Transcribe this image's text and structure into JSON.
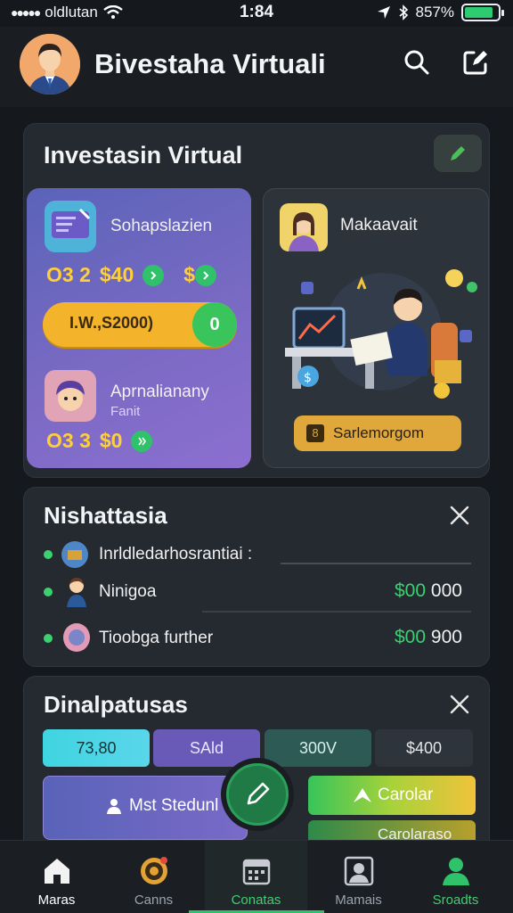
{
  "status_bar": {
    "carrier": "oldlutan",
    "time": "1:84",
    "battery": "857%",
    "battery_level": 0.86
  },
  "header": {
    "title": "Bivestaha Virtuali",
    "search_icon": "search-icon",
    "edit_icon": "edit-icon"
  },
  "investment": {
    "title": "Investasin Virtual",
    "card1": {
      "name": "Sohapslazien",
      "stat_a": "O3 2",
      "stat_b": "$40",
      "stat_c": "$",
      "button_label": "I.W.,S2000)",
      "button_badge": "0"
    },
    "card2": {
      "name": "Aprnalianany",
      "sub": "Fanit",
      "stat_a": "O3 3",
      "stat_b": "$0"
    },
    "card3": {
      "name": "Makaavait",
      "button_label": "Sarlemorgom"
    }
  },
  "history": {
    "title": "Nishattasia",
    "rows": [
      {
        "label": "Inrldledarhosrantiai :",
        "amount": "",
        "amount_tail": ""
      },
      {
        "label": "Ninigoa",
        "amount": "$00",
        "amount_tail": "000"
      },
      {
        "label": "Tioobga further",
        "amount": "$00",
        "amount_tail": "900"
      }
    ]
  },
  "dinal": {
    "title": "Dinalpatusas",
    "segments": [
      "73,80",
      "SAld",
      "300V",
      "$400"
    ],
    "student_label": "Mst Stedunl",
    "green_button": "Carolar",
    "bottom_button": "Carolaraso"
  },
  "tabs": [
    {
      "label": "Maras",
      "icon": "home-icon"
    },
    {
      "label": "Canns",
      "icon": "target-icon"
    },
    {
      "label": "Conatas",
      "icon": "calendar-icon"
    },
    {
      "label": "Mamais",
      "icon": "portrait-icon"
    },
    {
      "label": "Sroadts",
      "icon": "profile-icon"
    }
  ],
  "colors": {
    "accent_green": "#2fc26a",
    "purple": "#7a6ac4",
    "yellow": "#ffcf3a",
    "background": "#15181d"
  }
}
